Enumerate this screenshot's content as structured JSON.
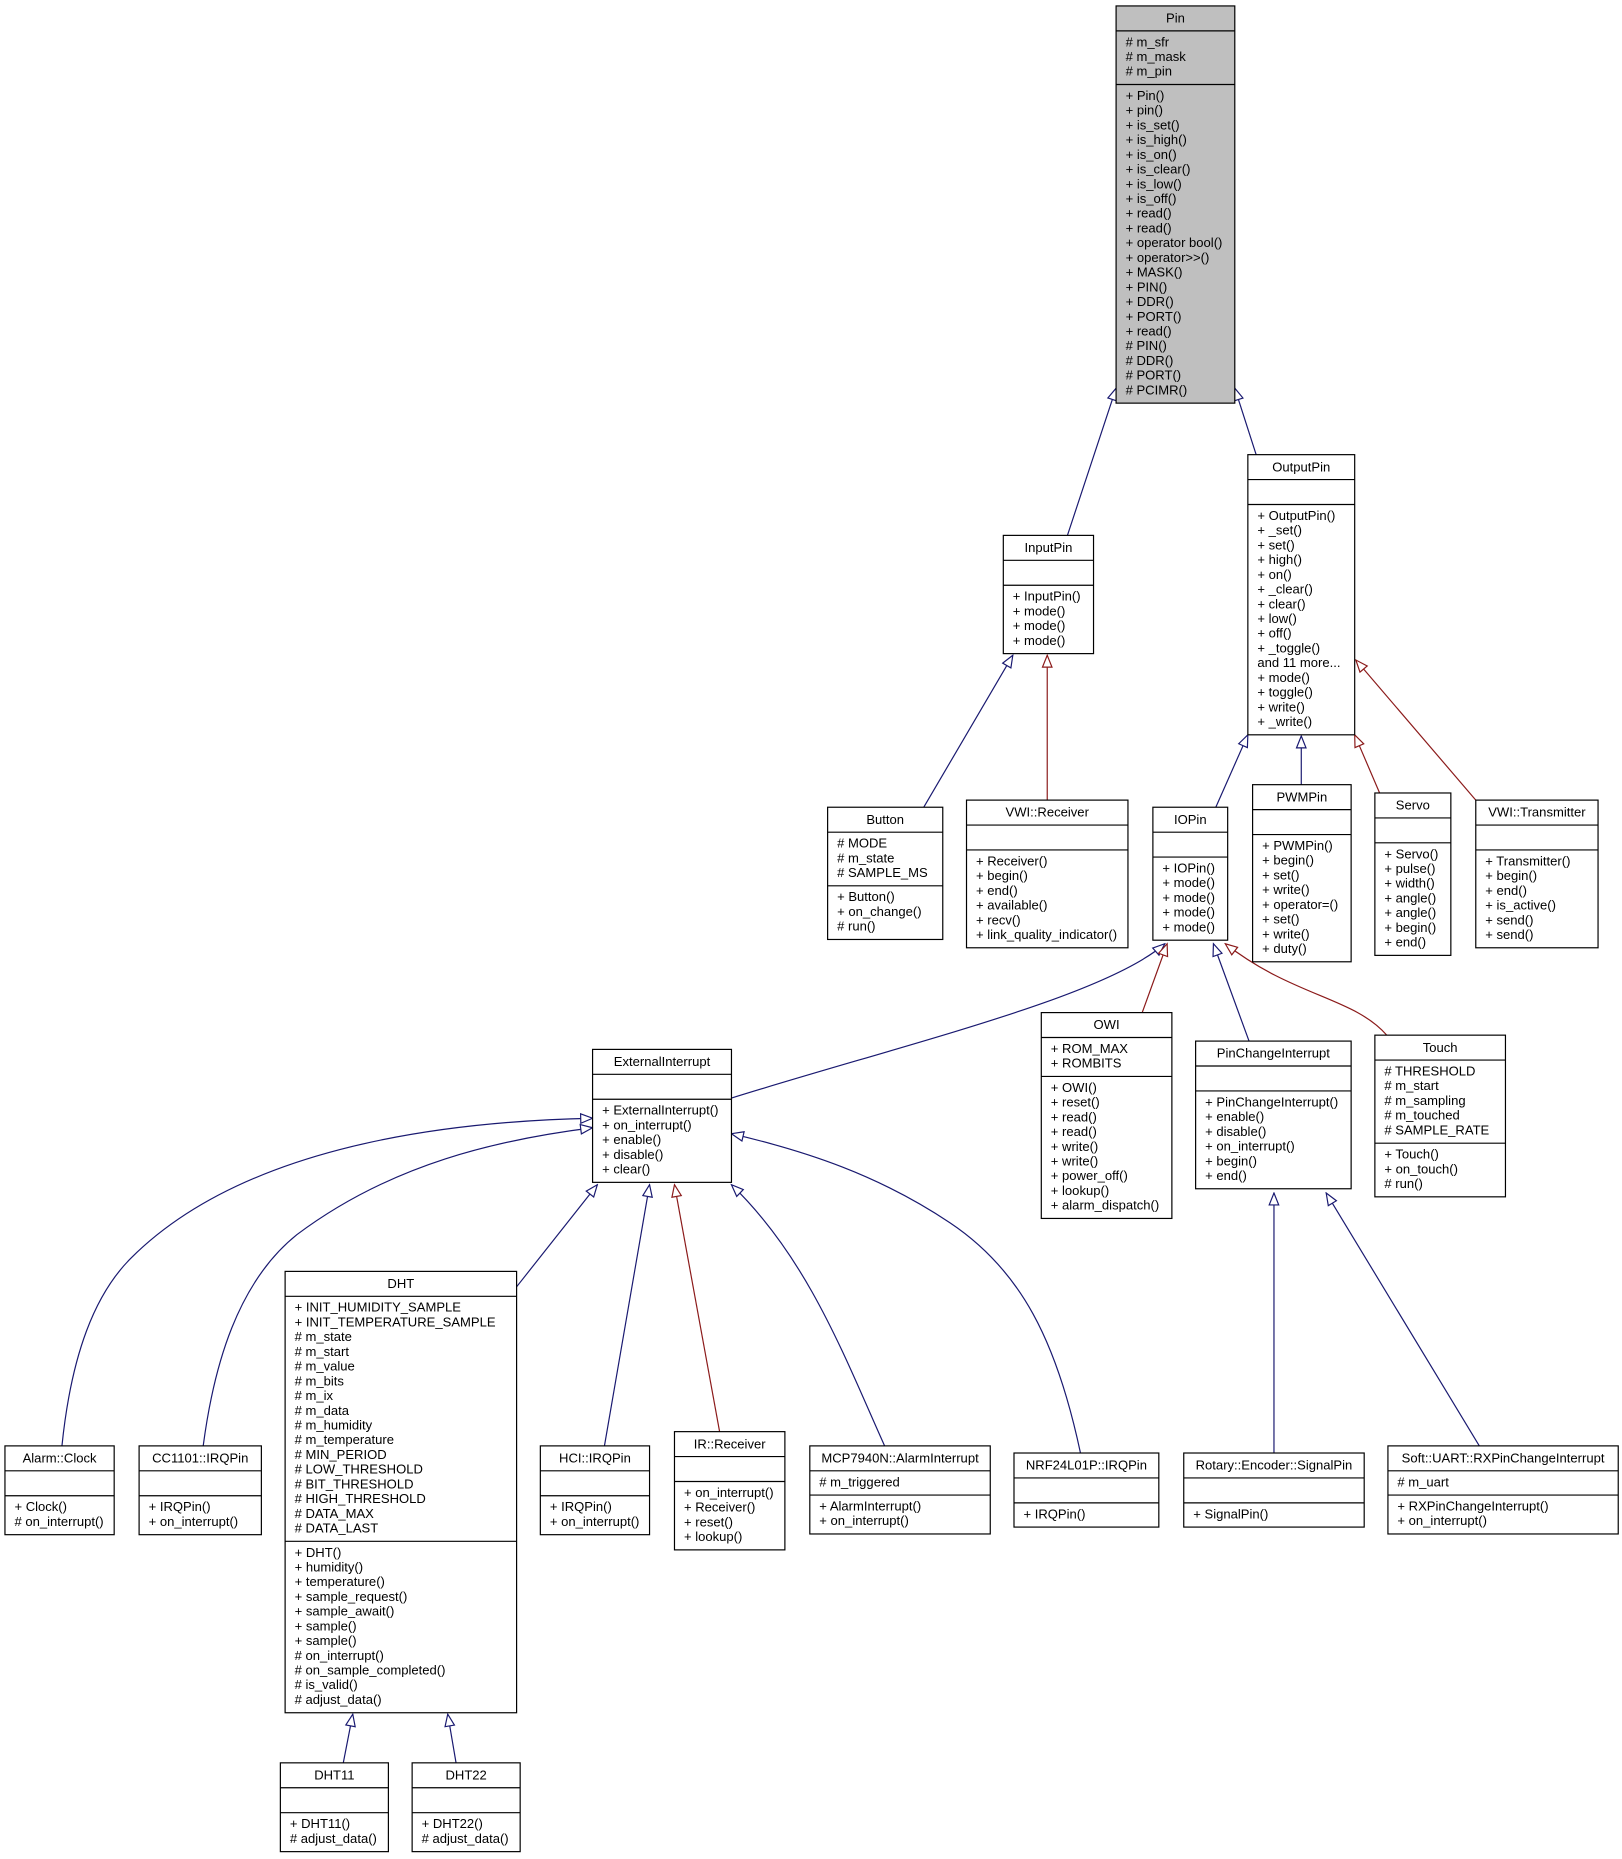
{
  "diagram": {
    "type": "class-inheritance-graph",
    "colors": {
      "root_fill": "#bfbfbf",
      "public_inheritance": "#191970",
      "protected_inheritance": "#8b1a1a"
    },
    "classes": [
      {
        "name": "Pin",
        "attributes": [
          "# m_sfr",
          "# m_mask",
          "# m_pin"
        ],
        "methods": [
          "+ Pin()",
          "+ pin()",
          "+ is_set()",
          "+ is_high()",
          "+ is_on()",
          "+ is_clear()",
          "+ is_low()",
          "+ is_off()",
          "+ read()",
          "+ read()",
          "+ operator bool()",
          "+ operator>>()",
          "+ MASK()",
          "+ PIN()",
          "+ DDR()",
          "+ PORT()",
          "+ read()",
          "# PIN()",
          "# DDR()",
          "# PORT()",
          "# PCIMR()"
        ]
      },
      {
        "name": "OutputPin",
        "attributes": [],
        "methods": [
          "+ OutputPin()",
          "+ _set()",
          "+ set()",
          "+ high()",
          "+ on()",
          "+ _clear()",
          "+ clear()",
          "+ low()",
          "+ off()",
          "+ _toggle()",
          "and 11 more...",
          "+ mode()",
          "+ toggle()",
          "+ write()",
          "+ _write()"
        ]
      },
      {
        "name": "InputPin",
        "attributes": [],
        "methods": [
          "+ InputPin()",
          "+ mode()",
          "+ mode()",
          "+ mode()"
        ]
      },
      {
        "name": "Button",
        "attributes": [
          "# MODE",
          "# m_state",
          "# SAMPLE_MS"
        ],
        "methods": [
          "+ Button()",
          "+ on_change()",
          "# run()"
        ]
      },
      {
        "name": "VWI::Receiver",
        "attributes": [],
        "methods": [
          "+ Receiver()",
          "+ begin()",
          "+ end()",
          "+ available()",
          "+ recv()",
          "+ link_quality_indicator()"
        ]
      },
      {
        "name": "IOPin",
        "attributes": [],
        "methods": [
          "+ IOPin()",
          "+ mode()",
          "+ mode()",
          "+ mode()",
          "+ mode()"
        ]
      },
      {
        "name": "PWMPin",
        "attributes": [],
        "methods": [
          "+ PWMPin()",
          "+ begin()",
          "+ set()",
          "+ write()",
          "+ operator=()",
          "+ set()",
          "+ write()",
          "+ duty()"
        ]
      },
      {
        "name": "Servo",
        "attributes": [],
        "methods": [
          "+ Servo()",
          "+ pulse()",
          "+ width()",
          "+ angle()",
          "+ angle()",
          "+ begin()",
          "+ end()"
        ]
      },
      {
        "name": "VWI::Transmitter",
        "attributes": [],
        "methods": [
          "+ Transmitter()",
          "+ begin()",
          "+ end()",
          "+ is_active()",
          "+ send()",
          "+ send()"
        ]
      },
      {
        "name": "ExternalInterrupt",
        "attributes": [],
        "methods": [
          "+ ExternalInterrupt()",
          "+ on_interrupt()",
          "+ enable()",
          "+ disable()",
          "+ clear()"
        ]
      },
      {
        "name": "OWI",
        "attributes": [
          "+ ROM_MAX",
          "+ ROMBITS"
        ],
        "methods": [
          "+ OWI()",
          "+ reset()",
          "+ read()",
          "+ read()",
          "+ write()",
          "+ write()",
          "+ power_off()",
          "+ lookup()",
          "+ alarm_dispatch()"
        ]
      },
      {
        "name": "PinChangeInterrupt",
        "attributes": [],
        "methods": [
          "+ PinChangeInterrupt()",
          "+ enable()",
          "+ disable()",
          "+ on_interrupt()",
          "+ begin()",
          "+ end()"
        ]
      },
      {
        "name": "Touch",
        "attributes": [
          "# THRESHOLD",
          "# m_start",
          "# m_sampling",
          "# m_touched",
          "# SAMPLE_RATE"
        ],
        "methods": [
          "+ Touch()",
          "+ on_touch()",
          "# run()"
        ]
      },
      {
        "name": "DHT",
        "attributes": [
          "+ INIT_HUMIDITY_SAMPLE",
          "+ INIT_TEMPERATURE_SAMPLE",
          "# m_state",
          "# m_start",
          "# m_value",
          "# m_bits",
          "# m_ix",
          "# m_data",
          "# m_humidity",
          "# m_temperature",
          "# MIN_PERIOD",
          "# LOW_THRESHOLD",
          "# BIT_THRESHOLD",
          "# HIGH_THRESHOLD",
          "# DATA_MAX",
          "# DATA_LAST"
        ],
        "methods": [
          "+ DHT()",
          "+ humidity()",
          "+ temperature()",
          "+ sample_request()",
          "+ sample_await()",
          "+ sample()",
          "+ sample()",
          "# on_interrupt()",
          "# on_sample_completed()",
          "# is_valid()",
          "# adjust_data()"
        ]
      },
      {
        "name": "Alarm::Clock",
        "attributes": [],
        "methods": [
          "+ Clock()",
          "# on_interrupt()"
        ]
      },
      {
        "name": "CC1101::IRQPin",
        "attributes": [],
        "methods": [
          "+ IRQPin()",
          "+ on_interrupt()"
        ]
      },
      {
        "name": "HCI::IRQPin",
        "attributes": [],
        "methods": [
          "+ IRQPin()",
          "+ on_interrupt()"
        ]
      },
      {
        "name": "IR::Receiver",
        "attributes": [],
        "methods": [
          "+ on_interrupt()",
          "+ Receiver()",
          "+ reset()",
          "+ lookup()"
        ]
      },
      {
        "name": "MCP7940N::AlarmInterrupt",
        "attributes": [
          "# m_triggered"
        ],
        "methods": [
          "+ AlarmInterrupt()",
          "+ on_interrupt()"
        ]
      },
      {
        "name": "NRF24L01P::IRQPin",
        "attributes": [],
        "methods": [
          "+ IRQPin()"
        ]
      },
      {
        "name": "Rotary::Encoder::SignalPin",
        "attributes": [],
        "methods": [
          "+ SignalPin()"
        ]
      },
      {
        "name": "Soft::UART::RXPinChangeInterrupt",
        "attributes": [
          "# m_uart"
        ],
        "methods": [
          "+ RXPinChangeInterrupt()",
          "+ on_interrupt()"
        ]
      },
      {
        "name": "DHT11",
        "attributes": [],
        "methods": [
          "+ DHT11()",
          "# adjust_data()"
        ]
      },
      {
        "name": "DHT22",
        "attributes": [],
        "methods": [
          "+ DHT22()",
          "# adjust_data()"
        ]
      }
    ],
    "inheritance": [
      {
        "child": "InputPin",
        "parent": "Pin",
        "kind": "public"
      },
      {
        "child": "OutputPin",
        "parent": "Pin",
        "kind": "public"
      },
      {
        "child": "Button",
        "parent": "InputPin",
        "kind": "public"
      },
      {
        "child": "VWI::Receiver",
        "parent": "InputPin",
        "kind": "protected"
      },
      {
        "child": "IOPin",
        "parent": "OutputPin",
        "kind": "public"
      },
      {
        "child": "PWMPin",
        "parent": "OutputPin",
        "kind": "public"
      },
      {
        "child": "Servo",
        "parent": "OutputPin",
        "kind": "protected"
      },
      {
        "child": "VWI::Transmitter",
        "parent": "OutputPin",
        "kind": "protected"
      },
      {
        "child": "ExternalInterrupt",
        "parent": "IOPin",
        "kind": "public"
      },
      {
        "child": "OWI",
        "parent": "IOPin",
        "kind": "protected"
      },
      {
        "child": "PinChangeInterrupt",
        "parent": "IOPin",
        "kind": "public"
      },
      {
        "child": "Touch",
        "parent": "IOPin",
        "kind": "protected"
      },
      {
        "child": "Alarm::Clock",
        "parent": "ExternalInterrupt",
        "kind": "public"
      },
      {
        "child": "CC1101::IRQPin",
        "parent": "ExternalInterrupt",
        "kind": "public"
      },
      {
        "child": "DHT",
        "parent": "ExternalInterrupt",
        "kind": "public"
      },
      {
        "child": "HCI::IRQPin",
        "parent": "ExternalInterrupt",
        "kind": "public"
      },
      {
        "child": "IR::Receiver",
        "parent": "ExternalInterrupt",
        "kind": "protected"
      },
      {
        "child": "MCP7940N::AlarmInterrupt",
        "parent": "ExternalInterrupt",
        "kind": "public"
      },
      {
        "child": "NRF24L01P::IRQPin",
        "parent": "ExternalInterrupt",
        "kind": "public"
      },
      {
        "child": "Rotary::Encoder::SignalPin",
        "parent": "PinChangeInterrupt",
        "kind": "public"
      },
      {
        "child": "Soft::UART::RXPinChangeInterrupt",
        "parent": "PinChangeInterrupt",
        "kind": "public"
      },
      {
        "child": "DHT11",
        "parent": "DHT",
        "kind": "public"
      },
      {
        "child": "DHT22",
        "parent": "DHT",
        "kind": "public"
      }
    ]
  }
}
